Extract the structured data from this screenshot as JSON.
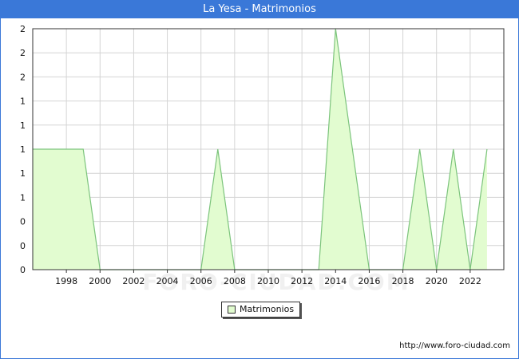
{
  "window": {
    "title": "La Yesa - Matrimonios"
  },
  "watermark": "FORO-CIUDAD.COM",
  "source_text": "http://www.foro-ciudad.com",
  "colors": {
    "title_bar": "#3a78d8",
    "area_fill": "#e2fcd0",
    "area_line": "#7cc47c",
    "grid": "#d4d4d4"
  },
  "chart_data": {
    "type": "area",
    "title": "La Yesa - Matrimonios",
    "xlabel": "",
    "ylabel": "",
    "x": [
      1996,
      1997,
      1998,
      1999,
      2000,
      2001,
      2002,
      2003,
      2004,
      2005,
      2006,
      2007,
      2008,
      2009,
      2010,
      2011,
      2012,
      2013,
      2014,
      2015,
      2016,
      2017,
      2018,
      2019,
      2020,
      2021,
      2022,
      2023
    ],
    "series": [
      {
        "name": "Matrimonios",
        "values": [
          1,
          1,
          1,
          1,
          0,
          0,
          0,
          0,
          0,
          0,
          0,
          1,
          0,
          0,
          0,
          0,
          0,
          0,
          2,
          1,
          0,
          0,
          0,
          1,
          0,
          1,
          0,
          1
        ]
      }
    ],
    "x_ticks": [
      "1998",
      "2000",
      "2002",
      "2004",
      "2006",
      "2008",
      "2010",
      "2012",
      "2014",
      "2016",
      "2018",
      "2020",
      "2022"
    ],
    "y_ticks": [
      "0",
      "0",
      "0",
      "1",
      "1",
      "1",
      "1",
      "1",
      "2",
      "2",
      "2"
    ],
    "ylim": [
      0,
      2
    ],
    "xlim": [
      1996,
      2024
    ],
    "grid": true,
    "legend": "bottom-center"
  }
}
